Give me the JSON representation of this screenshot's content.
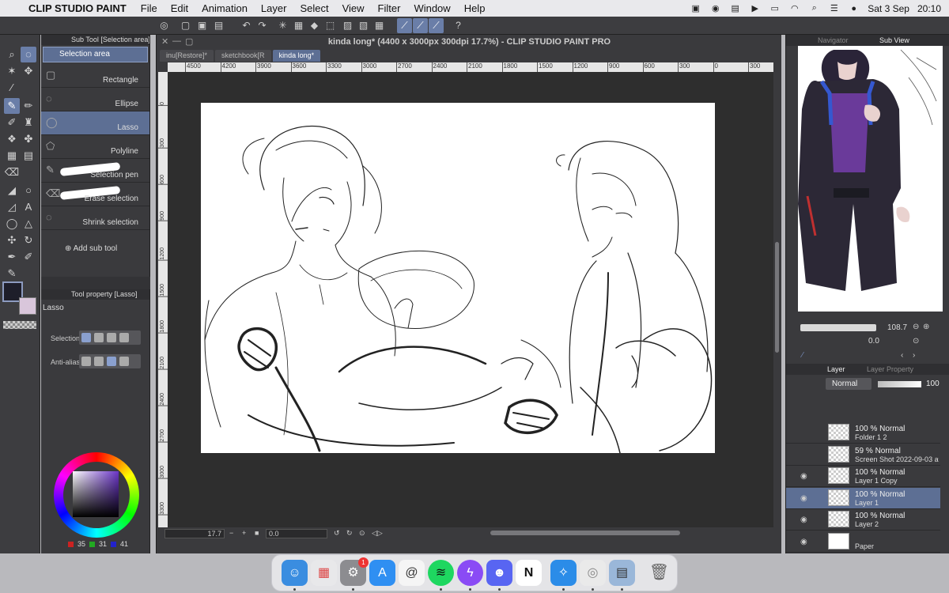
{
  "menubar": {
    "app_name": "CLIP STUDIO PAINT",
    "menus": [
      "File",
      "Edit",
      "Animation",
      "Layer",
      "Select",
      "View",
      "Filter",
      "Window",
      "Help"
    ],
    "date": "Sat 3 Sep",
    "time": "20:10"
  },
  "subtool": {
    "panel_title": "Sub Tool [Selection area]",
    "group": "Selection area",
    "items": [
      {
        "label": "Rectangle",
        "icon": "rectangle-icon"
      },
      {
        "label": "Ellipse",
        "icon": "ellipse-icon"
      },
      {
        "label": "Lasso",
        "icon": "lasso-icon"
      },
      {
        "label": "Polyline",
        "icon": "polyline-icon"
      },
      {
        "label": "Selection pen",
        "icon": "selection-pen-icon"
      },
      {
        "label": "Erase selection",
        "icon": "erase-selection-icon"
      },
      {
        "label": "Shrink selection",
        "icon": "shrink-selection-icon"
      }
    ],
    "active_index": 2,
    "add_label": "Add sub tool"
  },
  "toolprop": {
    "panel_title": "Tool property [Lasso]",
    "tool_name": "Lasso",
    "selection_label": "Selection",
    "antialias_label": "Anti-alias"
  },
  "color": {
    "r": "35",
    "g": "31",
    "b": "41",
    "main_color": "#1e1e2a",
    "sub_color": "#d9c6db"
  },
  "canvas": {
    "window_title": "kinda long* (4400 x 3000px 300dpi 17.7%)  - CLIP STUDIO PAINT PRO",
    "tabs": [
      {
        "label": "inu[Restore]*",
        "active": false
      },
      {
        "label": "sketchbook[R",
        "active": false
      },
      {
        "label": "kinda long*",
        "active": true
      }
    ],
    "ruler_h": [
      "4500",
      "4200",
      "3900",
      "3600",
      "3300",
      "3000",
      "2700",
      "2400",
      "2100",
      "1800",
      "1500",
      "1200",
      "900",
      "600",
      "300",
      "0",
      "300"
    ],
    "ruler_v": [
      "0",
      "300",
      "600",
      "900",
      "1200",
      "1500",
      "1800",
      "2100",
      "2400",
      "2700",
      "3000",
      "3300"
    ],
    "zoom": "17.7",
    "angle": "0.0"
  },
  "navigator": {
    "tabs": [
      "Navigator",
      "Sub View"
    ],
    "active_tab": 1,
    "zoom": "108.7",
    "angle": "0.0"
  },
  "layers": {
    "tabs": [
      "Layer",
      "Layer Property"
    ],
    "blend_mode": "Normal",
    "opacity": "100",
    "rows": [
      {
        "line1": "100 % Normal",
        "line2": "Folder 1 2",
        "visible": false,
        "active": false
      },
      {
        "line1": "59 % Normal",
        "line2": "Screen Shot 2022-09-03 at 16...",
        "visible": false,
        "active": false
      },
      {
        "line1": "100 % Normal",
        "line2": "Layer 1 Copy",
        "visible": true,
        "active": false
      },
      {
        "line1": "100 % Normal",
        "line2": "Layer 1",
        "visible": true,
        "active": true
      },
      {
        "line1": "100 % Normal",
        "line2": "Layer 2",
        "visible": true,
        "active": false
      },
      {
        "line1": "",
        "line2": "Paper",
        "visible": true,
        "active": false
      }
    ]
  },
  "dock": {
    "apps": [
      "Finder",
      "Launchpad",
      "System Preferences",
      "App Store",
      "Clip Studio",
      "Spotify",
      "Messenger",
      "Discord",
      "Notion",
      "Safari",
      "Clip Studio Paint",
      "Preview",
      "Trash"
    ],
    "badge": "1"
  }
}
